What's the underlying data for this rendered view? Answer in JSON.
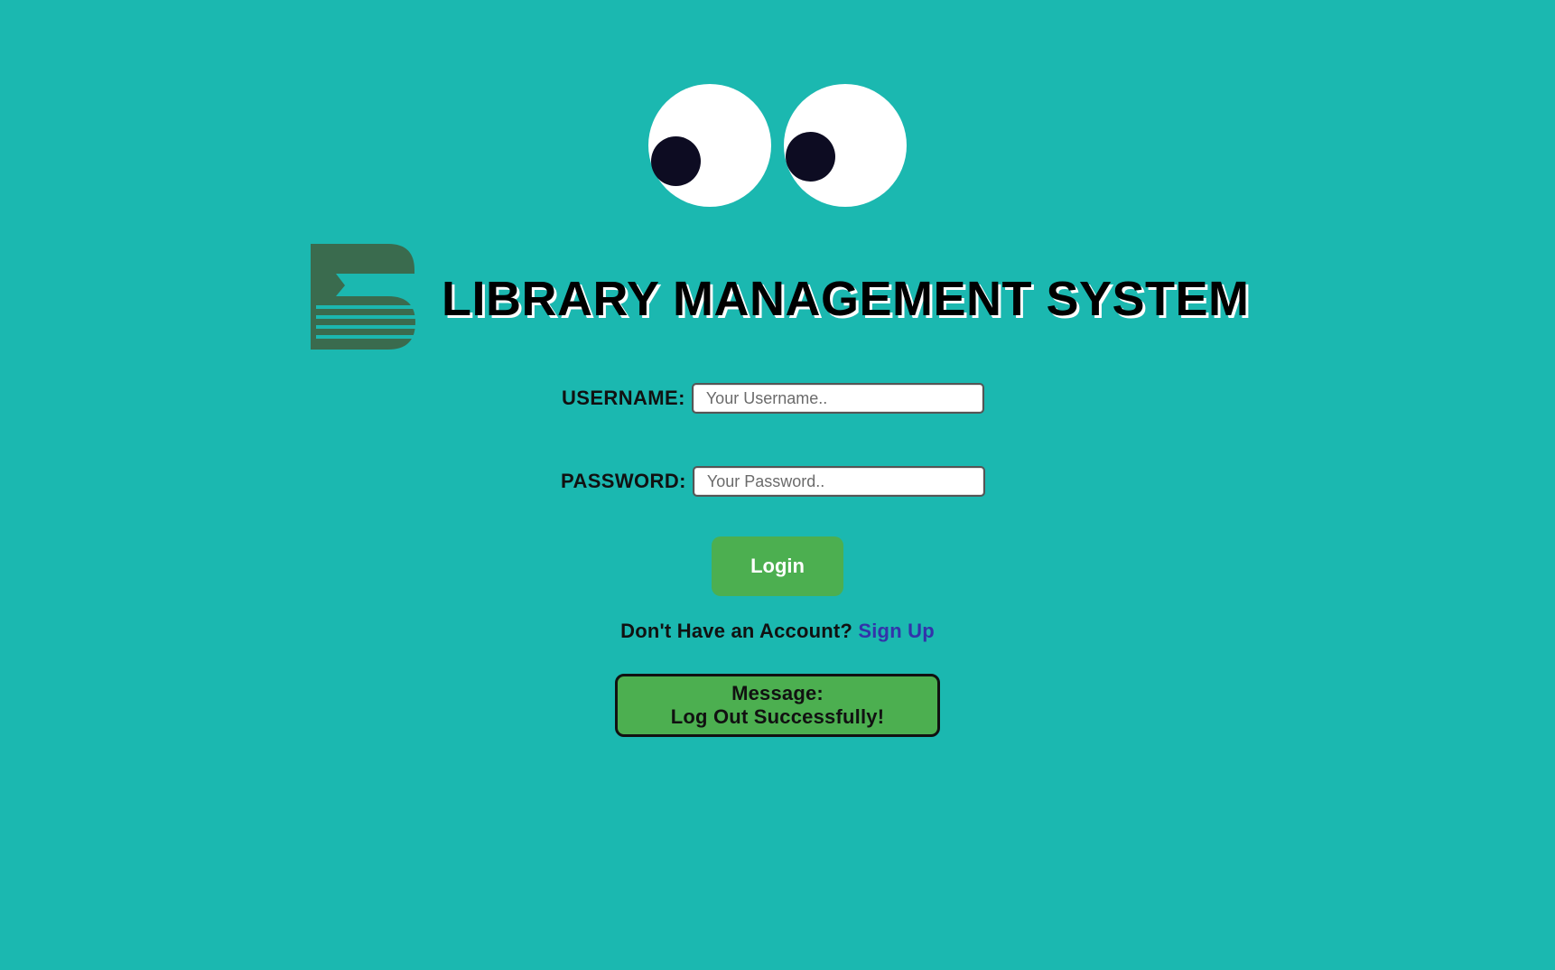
{
  "header": {
    "title": "LIBRARY MANAGEMENT SYSTEM",
    "logo_icon": "book-stack-logo-icon",
    "decoration_icon": "googly-eyes-icon"
  },
  "form": {
    "username_label": "USERNAME:",
    "username_placeholder": "Your Username..",
    "username_value": "",
    "password_label": "PASSWORD:",
    "password_placeholder": "Your Password..",
    "password_value": "",
    "login_label": "Login"
  },
  "signup": {
    "prompt": "Don't Have an Account?",
    "link_label": "Sign Up"
  },
  "message": {
    "heading": "Message:",
    "text": "Log Out Successfully!"
  },
  "colors": {
    "background": "#1bb8b0",
    "button": "#4caf50",
    "logo": "#3a6b4e",
    "link": "#3333aa"
  }
}
